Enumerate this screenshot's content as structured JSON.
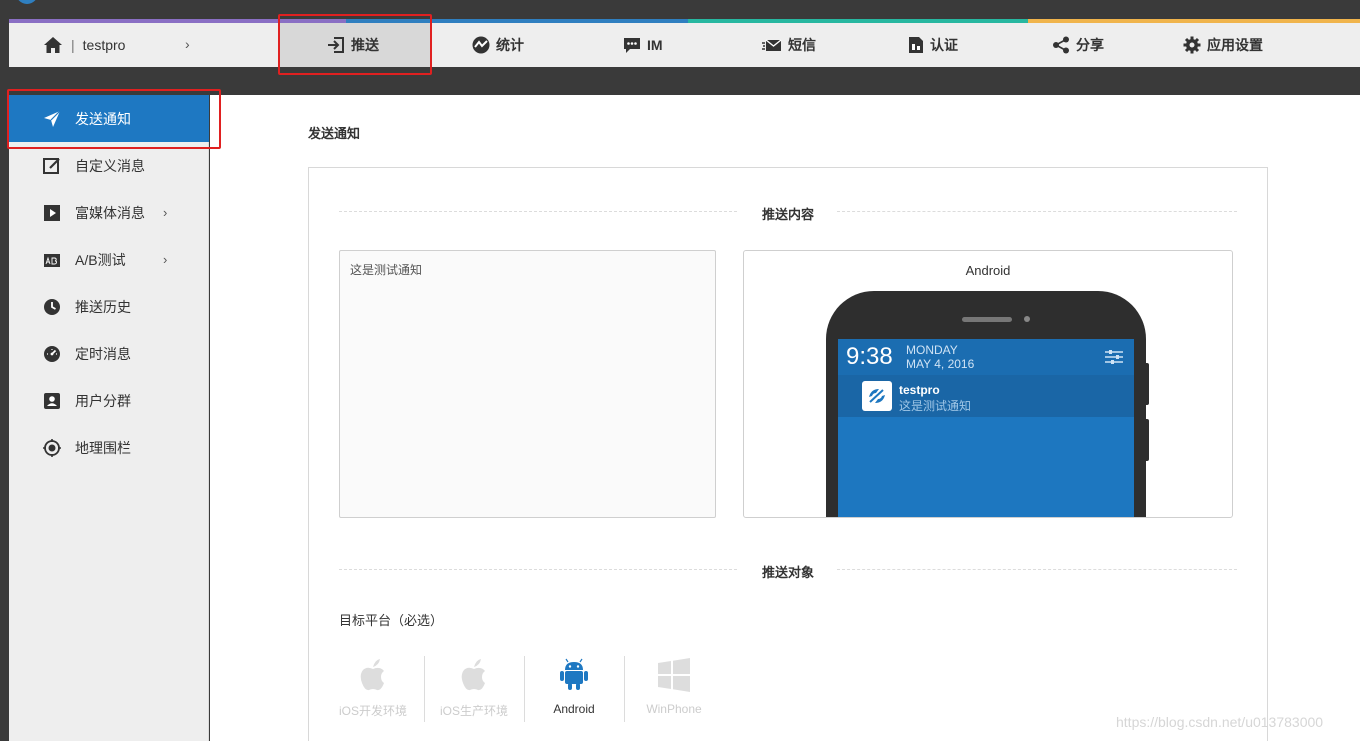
{
  "nav": {
    "project": "testpro",
    "separator": "|",
    "items": [
      {
        "label": "推送",
        "icon": "push-in-icon"
      },
      {
        "label": "统计",
        "icon": "stats-icon"
      },
      {
        "label": "IM",
        "icon": "chat-icon"
      },
      {
        "label": "短信",
        "icon": "sms-icon"
      },
      {
        "label": "认证",
        "icon": "certify-icon"
      },
      {
        "label": "分享",
        "icon": "share-icon"
      },
      {
        "label": "应用设置",
        "icon": "gear-icon"
      }
    ],
    "strip_colors": [
      "#8a6fc4",
      "#2f7fc0",
      "#27b7a0",
      "#f0b44c"
    ]
  },
  "sidebar": {
    "items": [
      {
        "label": "发送通知",
        "icon": "send-icon"
      },
      {
        "label": "自定义消息",
        "icon": "edit-icon"
      },
      {
        "label": "富媒体消息",
        "icon": "play-icon"
      },
      {
        "label": "A/B测试",
        "icon": "ab-icon"
      },
      {
        "label": "推送历史",
        "icon": "clock-icon"
      },
      {
        "label": "定时消息",
        "icon": "timer-icon"
      },
      {
        "label": "用户分群",
        "icon": "user-group-icon"
      },
      {
        "label": "地理围栏",
        "icon": "geofence-icon"
      }
    ]
  },
  "main": {
    "title": "发送通知",
    "content_section": "推送内容",
    "target_section": "推送对象",
    "message_text": "这是测试通知",
    "preview": {
      "platform": "Android",
      "time": "9:38",
      "weekday": "MONDAY",
      "date": "MAY 4, 2016",
      "app_name": "testpro",
      "message": "这是测试通知"
    },
    "target_platform_label": "目标平台（必选）",
    "platforms": [
      {
        "label": "iOS开发环境",
        "selected": false
      },
      {
        "label": "iOS生产环境",
        "selected": false
      },
      {
        "label": "Android",
        "selected": true
      },
      {
        "label": "WinPhone",
        "selected": false
      }
    ]
  },
  "colors": {
    "accent": "#1e78c2",
    "highlight_box": "#e02020"
  },
  "watermark": "https://blog.csdn.net/u013783000"
}
